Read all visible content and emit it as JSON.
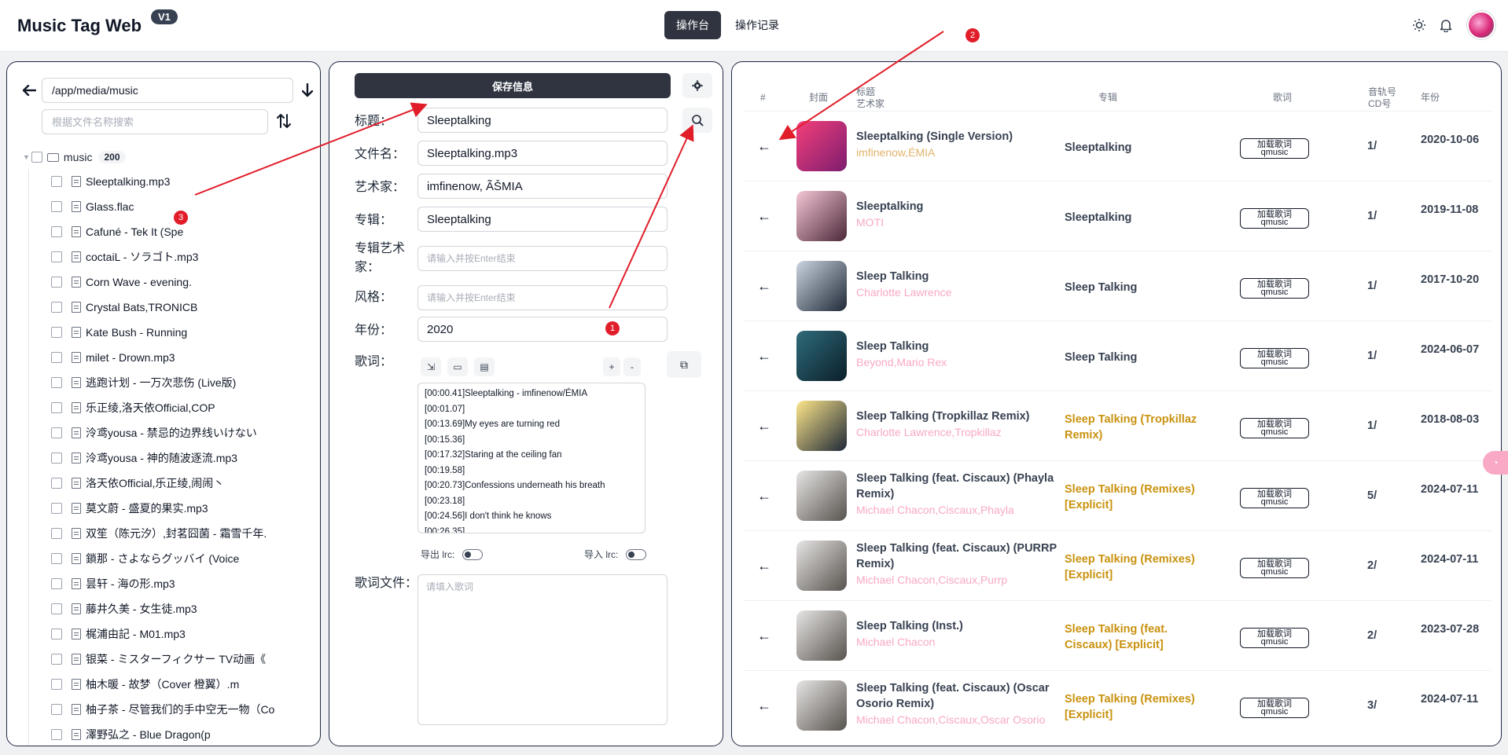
{
  "header": {
    "app_title": "Music Tag Web",
    "version": "V1",
    "tabs": [
      {
        "label": "操作台",
        "active": true
      },
      {
        "label": "操作记录",
        "active": false
      }
    ]
  },
  "file_panel": {
    "path": "/app/media/music",
    "search_placeholder": "根据文件名称搜索",
    "root_folder": {
      "name": "music",
      "count": "200"
    },
    "files": [
      "Sleeptalking.mp3",
      "Glass.flac",
      "Cafuné - Tek It (Spe",
      "coctaiL - ソラゴト.mp3",
      "Corn Wave - evening.",
      "Crystal Bats,TRONICB",
      "Kate Bush - Running",
      "milet - Drown.mp3",
      "逃跑计划 - 一万次悲伤 (Live版)",
      "乐正绫,洛天依Official,COP",
      "泠鸢yousa - 禁忌的边界线いけない",
      "泠鸢yousa - 神的随波逐流.mp3",
      "洛天依Official,乐正绫,闹闹丶",
      "莫文蔚 - 盛夏的果实.mp3",
      "双笙（陈元汐）,封茗囧菌 - 霜雪千年.",
      "鎖那 - さよならグッバイ (Voice",
      "昙轩 - 海の形.mp3",
      "藤井久美 - 女生徒.mp3",
      "梶浦由記 - M01.mp3",
      "银菜 - ミスターフィクサー TV动画《",
      "柚木暖 - 故梦（Cover 橙翼）.m",
      "柚子茶 - 尽管我们的手中空无一物（Co",
      "澤野弘之 - Blue Dragon(p"
    ]
  },
  "editor": {
    "save_label": "保存信息",
    "fields": {
      "title": {
        "label": "标题：",
        "value": "Sleeptalking"
      },
      "filename": {
        "label": "文件名：",
        "value": "Sleeptalking.mp3"
      },
      "artist": {
        "label": "艺术家：",
        "value": "imfinenow, ÃŠMIA"
      },
      "album": {
        "label": "专辑：",
        "value": "Sleeptalking"
      },
      "album_artist": {
        "label_line1": "专辑艺术",
        "label_line2": "家：",
        "placeholder": "请输入并按Enter结束"
      },
      "genre": {
        "label": "风格：",
        "placeholder": "请输入并按Enter结束"
      },
      "year": {
        "label": "年份：",
        "value": "2020"
      }
    },
    "lyrics_label": "歌词：",
    "lyric_zoom_in": "+",
    "lyric_zoom_out": "-",
    "lyrics_lines": [
      "[00:00.41]Sleeptalking - imfinenow/ÉMIA",
      "[00:01.07]",
      "[00:13.69]My eyes are turning red",
      "[00:15.36]",
      "[00:17.32]Staring at the ceiling fan",
      "[00:19.58]",
      "[00:20.73]Confessions underneath his breath",
      "[00:23.18]",
      "[00:24.56]I don't think he knows",
      "[00:26.35]"
    ],
    "export_lrc_label": "导出 lrc:",
    "import_lrc_label": "导入 lrc:",
    "lyric_file_label": "歌词文件：",
    "lyric_file_placeholder": "请填入歌词"
  },
  "results": {
    "headers": {
      "index": "#",
      "cover": "封面",
      "title": "标题",
      "artist": "艺术家",
      "album": "专辑",
      "lyrics": "歌词",
      "track": "音轨号",
      "cd": "CD号",
      "year": "年份"
    },
    "lyric_button_line1": "加载歌词",
    "lyric_button_line2": "qmusic",
    "rows": [
      {
        "title": "Sleeptalking (Single Version)",
        "artist": "imfinenow,ÉMIA",
        "album": "Sleeptalking",
        "album_match": false,
        "track": "1/",
        "year": "2020-10-06",
        "artist_color": "#e0b36a",
        "cover_colors": [
          "#f43f7a",
          "#7c1d6f"
        ]
      },
      {
        "title": "Sleeptalking",
        "artist": "MOTI",
        "album": "Sleeptalking",
        "album_match": false,
        "track": "1/",
        "year": "2019-11-08",
        "artist_color": "#f9a8c6",
        "cover_colors": [
          "#f5c6d6",
          "#4b2838"
        ]
      },
      {
        "title": "Sleep Talking",
        "artist": "Charlotte Lawrence",
        "album": "Sleep Talking",
        "album_match": false,
        "track": "1/",
        "year": "2017-10-20",
        "artist_color": "#f9a8c6",
        "cover_colors": [
          "#cbd5e1",
          "#1f2937"
        ]
      },
      {
        "title": "Sleep Talking",
        "artist": "Beyond,Mario Rex",
        "album": "Sleep Talking",
        "album_match": false,
        "track": "1/",
        "year": "2024-06-07",
        "artist_color": "#f9a8c6",
        "cover_colors": [
          "#2f6b7a",
          "#0b1f2a"
        ]
      },
      {
        "title": "Sleep Talking (Tropkillaz Remix)",
        "artist": "Charlotte Lawrence,Tropkillaz",
        "album": "Sleep Talking (Tropkillaz Remix)",
        "album_match": true,
        "track": "1/",
        "year": "2018-08-03",
        "artist_color": "#f9a8c6",
        "cover_colors": [
          "#fde68a",
          "#1f2937"
        ]
      },
      {
        "title": "Sleep Talking (feat. Ciscaux) (Phayla Remix)",
        "artist": "Michael Chacon,Ciscaux,Phayla",
        "album": "Sleep Talking (Remixes) [Explicit]",
        "album_match": true,
        "track": "5/",
        "year": "2024-07-11",
        "artist_color": "#f9a8c6",
        "cover_colors": [
          "#e7e5e4",
          "#57534e"
        ]
      },
      {
        "title": "Sleep Talking (feat. Ciscaux) (PURRP Remix)",
        "artist": "Michael Chacon,Ciscaux,Purrp",
        "album": "Sleep Talking (Remixes) [Explicit]",
        "album_match": true,
        "track": "2/",
        "year": "2024-07-11",
        "artist_color": "#f9a8c6",
        "cover_colors": [
          "#e7e5e4",
          "#57534e"
        ]
      },
      {
        "title": "Sleep Talking (Inst.)",
        "artist": "Michael Chacon",
        "album": "Sleep Talking (feat. Ciscaux) [Explicit]",
        "album_match": true,
        "track": "2/",
        "year": "2023-07-28",
        "artist_color": "#f9a8c6",
        "cover_colors": [
          "#e7e5e4",
          "#57534e"
        ]
      },
      {
        "title": "Sleep Talking (feat. Ciscaux) (Oscar Osorio Remix)",
        "artist": "Michael Chacon,Ciscaux,Oscar Osorio",
        "album": "Sleep Talking (Remixes) [Explicit]",
        "album_match": true,
        "track": "3/",
        "year": "2024-07-11",
        "artist_color": "#f9a8c6",
        "cover_colors": [
          "#e7e5e4",
          "#57534e"
        ]
      }
    ]
  },
  "annotations": {
    "markers": [
      "1",
      "2",
      "3"
    ]
  },
  "colors": {
    "accent_dark": "#2f3440",
    "album_match": "#c9920e",
    "album_default": "#374151",
    "marker": "#e11d2a"
  },
  "icons": [
    "back-arrow-icon",
    "download-arrow-icon",
    "sort-icon",
    "gear-icon",
    "search-icon",
    "sun-icon",
    "bell-icon",
    "translate-icon"
  ]
}
